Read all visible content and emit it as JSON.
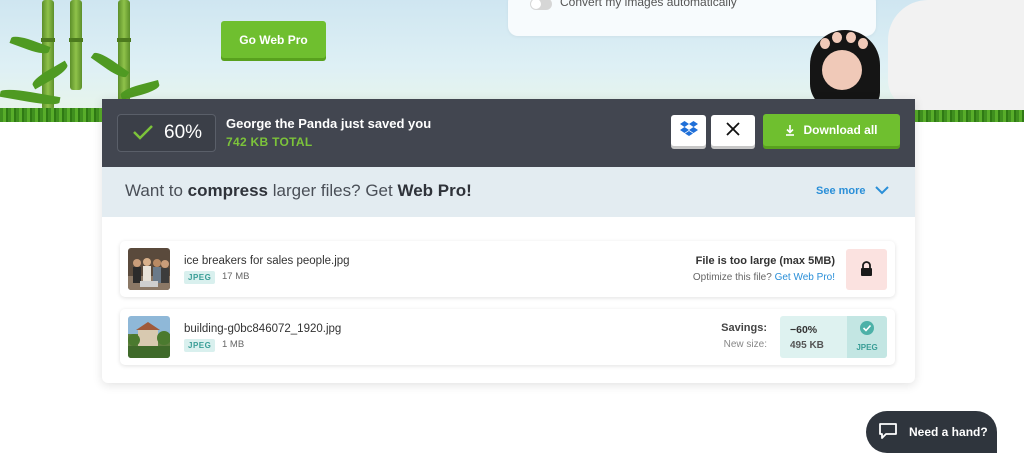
{
  "hero": {
    "go_pro_label": "Go Web Pro",
    "auto_convert_label": "Convert my images automatically"
  },
  "result": {
    "percent": "60%",
    "saved_title": "George the Panda just saved you",
    "saved_total": "742 KB TOTAL",
    "dropbox_icon": "dropbox-icon",
    "x_icon": "x-icon",
    "download_all_label": "Download all"
  },
  "promo": {
    "text_prefix": "Want to ",
    "text_bold1": "compress",
    "text_middle": " larger files? Get ",
    "text_bold2": "Web Pro!",
    "see_more_label": "See more"
  },
  "files": [
    {
      "name": "ice breakers for sales people.jpg",
      "format": "JPEG",
      "size": "17 MB",
      "error_title": "File is too large (max 5MB)",
      "error_sub": "Optimize this file?",
      "error_link": "Get Web Pro!"
    },
    {
      "name": "building-g0bc846072_1920.jpg",
      "format": "JPEG",
      "size": "1 MB",
      "savings_label": "Savings:",
      "new_size_label": "New size:",
      "savings_value": "−60%",
      "new_size_value": "495 KB",
      "output_format": "JPEG"
    }
  ],
  "help": {
    "label": "Need a hand?"
  },
  "colors": {
    "brand_green": "#6fbf2f",
    "dark_bar": "#424650",
    "link_blue": "#2a8fd8",
    "teal_badge": "#3a9e97"
  }
}
